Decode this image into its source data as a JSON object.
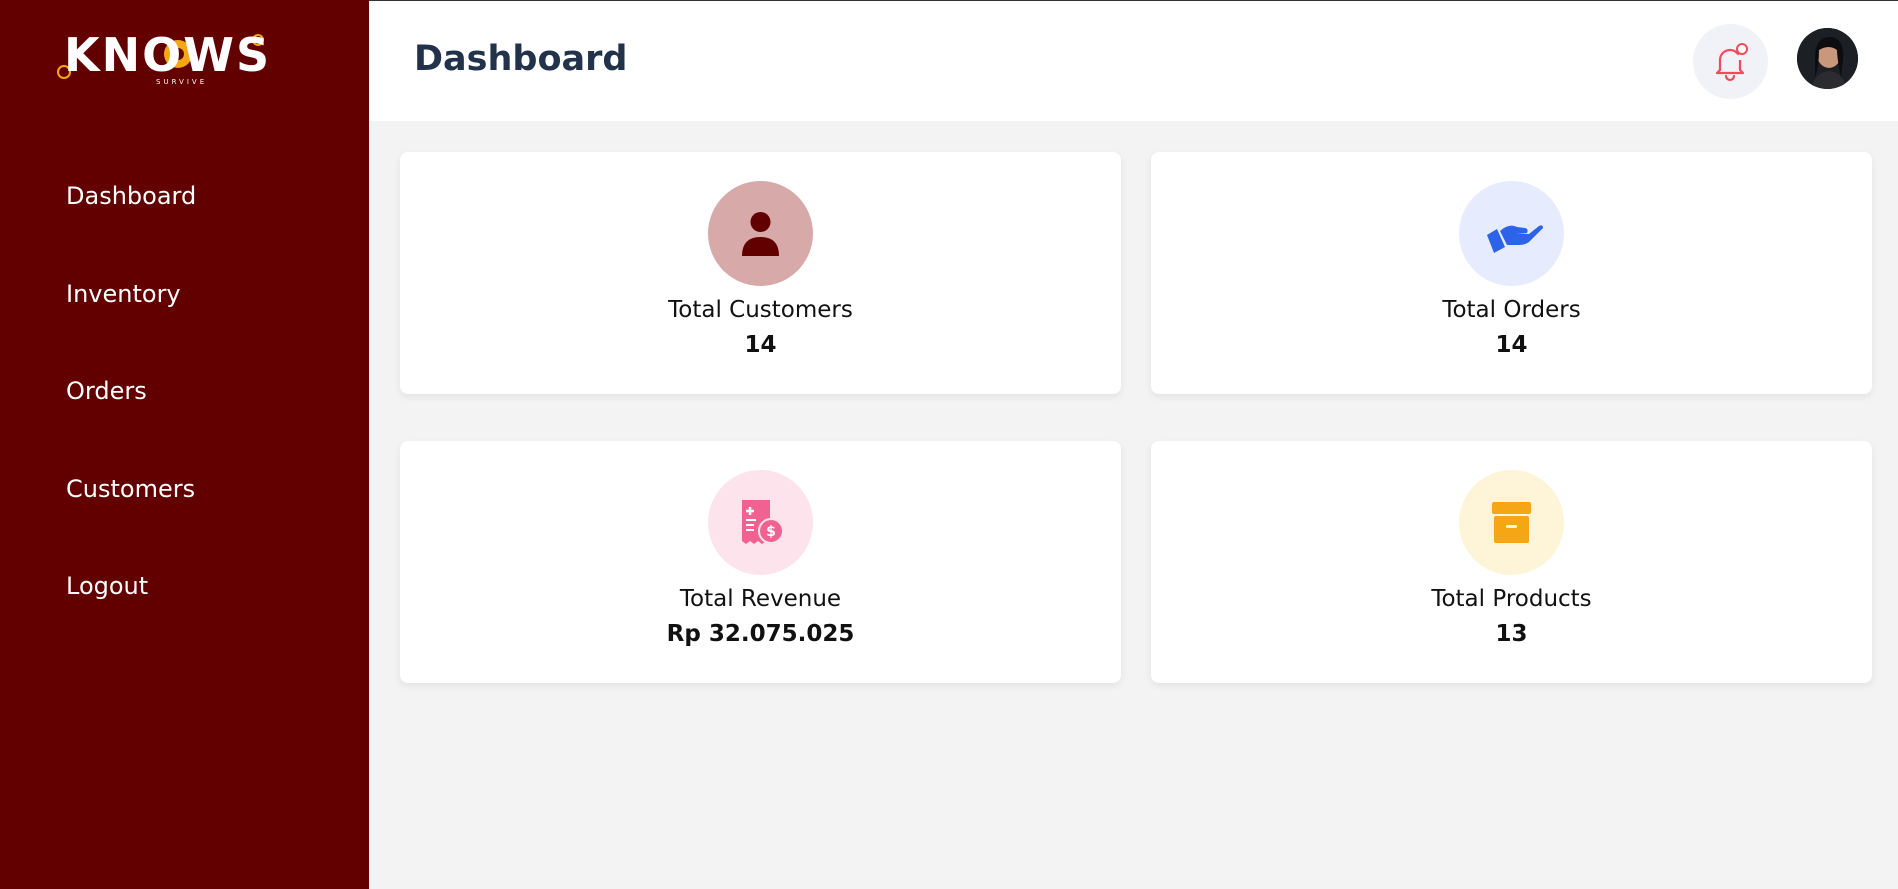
{
  "brand": {
    "logo_text": "KNOWS",
    "logo_subtext": "SURVIVE"
  },
  "sidebar": {
    "items": [
      {
        "label": "Dashboard"
      },
      {
        "label": "Inventory"
      },
      {
        "label": "Orders"
      },
      {
        "label": "Customers"
      },
      {
        "label": "Logout"
      }
    ]
  },
  "header": {
    "title": "Dashboard"
  },
  "cards": [
    {
      "label": "Total Customers",
      "value": "14",
      "icon": "user-icon",
      "icon_color": "#620000",
      "icon_bg": "#d8a9a9"
    },
    {
      "label": "Total Orders",
      "value": "14",
      "icon": "hand-holding-icon",
      "icon_color": "#2d63e8",
      "icon_bg": "#e6ecfd"
    },
    {
      "label": "Total Revenue",
      "value": "Rp 32.075.025",
      "icon": "receipt-icon",
      "icon_color": "#f06292",
      "icon_bg": "#fde3ec"
    },
    {
      "label": "Total Products",
      "value": "13",
      "icon": "archive-box-icon",
      "icon_color": "#f5a614",
      "icon_bg": "#fef4d8"
    }
  ],
  "colors": {
    "sidebar": "#620000",
    "title": "#22324a",
    "notification": "#ef4b5c"
  }
}
